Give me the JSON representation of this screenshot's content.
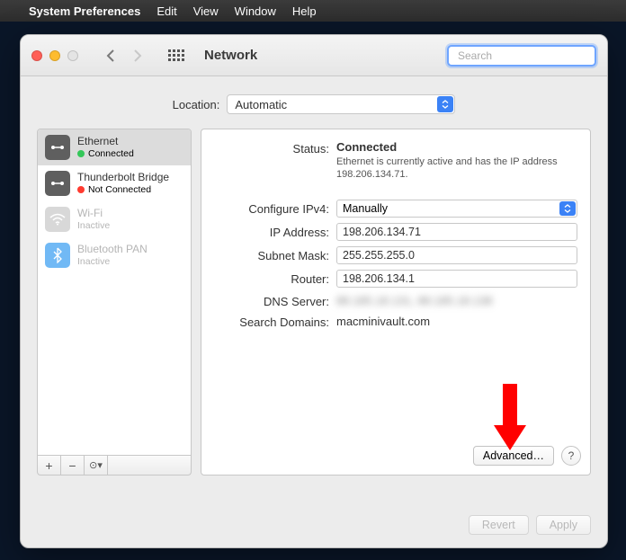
{
  "menubar": {
    "app": "System Preferences",
    "items": [
      "Edit",
      "View",
      "Window",
      "Help"
    ]
  },
  "window": {
    "title": "Network",
    "search_placeholder": "Search"
  },
  "location": {
    "label": "Location:",
    "value": "Automatic"
  },
  "sidebar": {
    "items": [
      {
        "name": "Ethernet",
        "status": "Connected",
        "dot": "green",
        "icon": "ethernet",
        "selected": true,
        "dim": false
      },
      {
        "name": "Thunderbolt Bridge",
        "status": "Not Connected",
        "dot": "red",
        "icon": "ethernet",
        "selected": false,
        "dim": false
      },
      {
        "name": "Wi-Fi",
        "status": "Inactive",
        "dot": "",
        "icon": "wifi",
        "selected": false,
        "dim": true
      },
      {
        "name": "Bluetooth PAN",
        "status": "Inactive",
        "dot": "",
        "icon": "bluetooth",
        "selected": false,
        "dim": true
      }
    ],
    "footer": {
      "add": "+",
      "remove": "−",
      "more": "⊙▾"
    }
  },
  "details": {
    "status_label": "Status:",
    "status_value": "Connected",
    "status_desc": "Ethernet is currently active and has the IP address 198.206.134.71.",
    "configure_label": "Configure IPv4:",
    "configure_value": "Manually",
    "ip_label": "IP Address:",
    "ip_value": "198.206.134.71",
    "subnet_label": "Subnet Mask:",
    "subnet_value": "255.255.255.0",
    "router_label": "Router:",
    "router_value": "198.206.134.1",
    "dns_label": "DNS Server:",
    "dns_value": "88.185.18.131, 88.185.18.138",
    "search_label": "Search Domains:",
    "search_value": "macminivault.com",
    "advanced": "Advanced…",
    "help": "?"
  },
  "buttons": {
    "revert": "Revert",
    "apply": "Apply"
  }
}
